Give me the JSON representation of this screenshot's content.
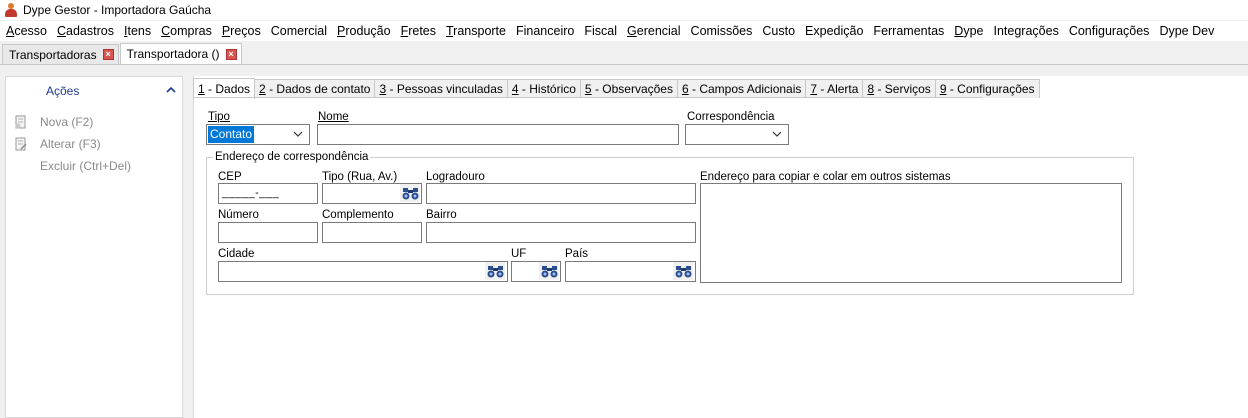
{
  "window": {
    "title": "Dype Gestor - Importadora Gaúcha"
  },
  "menu": [
    {
      "first": "A",
      "rest": "cesso"
    },
    {
      "first": "C",
      "rest": "adastros"
    },
    {
      "first": "I",
      "rest": "tens"
    },
    {
      "first": "C",
      "rest": "ompras"
    },
    {
      "first": "P",
      "rest": "reços"
    },
    {
      "first": "C",
      "rest": "omercial"
    },
    {
      "first": "P",
      "rest": "rodução"
    },
    {
      "first": "F",
      "rest": "retes"
    },
    {
      "first": "T",
      "rest": "ransporte"
    },
    {
      "first": "F",
      "rest": "inanceiro"
    },
    {
      "first": "F",
      "rest": "iscal"
    },
    {
      "first": "G",
      "rest": "erencial"
    },
    {
      "first": "C",
      "rest": "omissões"
    },
    {
      "first": "C",
      "rest": "usto"
    },
    {
      "first": "E",
      "rest": "xpedição"
    },
    {
      "first": "F",
      "rest": "erramentas"
    },
    {
      "first": "D",
      "rest": "ype"
    },
    {
      "first": "I",
      "rest": "ntegrações"
    },
    {
      "first": "C",
      "rest": "onfigurações"
    },
    {
      "first": "D",
      "rest": "ype Dev"
    }
  ],
  "doc_tabs": [
    {
      "label": "Transportadoras",
      "active": false
    },
    {
      "label": "Transportadora ()",
      "active": true
    }
  ],
  "actions_panel": {
    "title": "Ações",
    "items": [
      {
        "label": "Nova (F2)"
      },
      {
        "label": "Alterar (F3)"
      },
      {
        "label": "Excluir (Ctrl+Del)"
      }
    ]
  },
  "sub_tabs": [
    {
      "num": "1",
      "label": " - Dados"
    },
    {
      "num": "2",
      "label": " - Dados de contato"
    },
    {
      "num": "3",
      "label": " - Pessoas vinculadas"
    },
    {
      "num": "4",
      "label": " - Histórico"
    },
    {
      "num": "5",
      "label": " - Observações"
    },
    {
      "num": "6",
      "label": " - Campos Adicionais"
    },
    {
      "num": "7",
      "label": " - Alerta"
    },
    {
      "num": "8",
      "label": " - Serviços"
    },
    {
      "num": "9",
      "label": " - Configurações"
    }
  ],
  "form": {
    "tipo_label": "Tipo",
    "tipo_value": "Contato",
    "nome_label": "Nome",
    "nome_value": "",
    "correspondencia_label": "Correspondência",
    "correspondencia_value": "",
    "group_title": "Endereço de correspondência",
    "cep_label": "CEP",
    "cep_mask": "_____-___",
    "tipo_rua_label": "Tipo (Rua, Av.)",
    "logradouro_label": "Logradouro",
    "numero_label": "Número",
    "complemento_label": "Complemento",
    "bairro_label": "Bairro",
    "cidade_label": "Cidade",
    "uf_label": "UF",
    "pais_label": "País",
    "copy_address_label": "Endereço para copiar e colar em outros sistemas"
  },
  "colors": {
    "accent": "#1c3a8a",
    "selection": "#0078d7",
    "close": "#d9534f"
  }
}
